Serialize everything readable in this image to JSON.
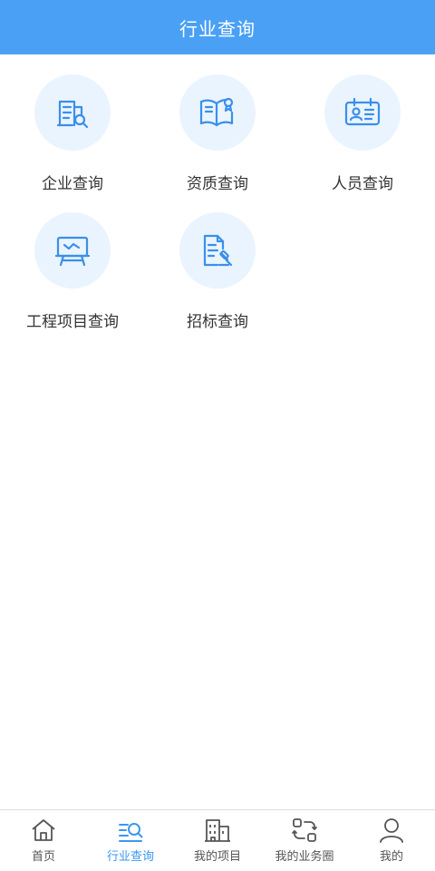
{
  "header": {
    "title": "行业查询"
  },
  "tiles": [
    {
      "label": "企业查询",
      "icon": "company-search-icon"
    },
    {
      "label": "资质查询",
      "icon": "qualification-book-icon"
    },
    {
      "label": "人员查询",
      "icon": "personnel-card-icon"
    },
    {
      "label": "工程项目查询",
      "icon": "project-board-icon"
    },
    {
      "label": "招标查询",
      "icon": "bidding-document-icon"
    }
  ],
  "tabbar": {
    "items": [
      {
        "label": "首页",
        "icon": "home-icon"
      },
      {
        "label": "行业查询",
        "icon": "industry-search-icon",
        "active": true
      },
      {
        "label": "我的项目",
        "icon": "building-icon"
      },
      {
        "label": "我的业务圈",
        "icon": "business-circle-icon"
      },
      {
        "label": "我的",
        "icon": "person-icon"
      }
    ]
  },
  "colors": {
    "primary": "#4aa0f5",
    "icon_blue": "#3b8fe8",
    "tile_bg": "#eaf4ff",
    "text": "#333333"
  }
}
